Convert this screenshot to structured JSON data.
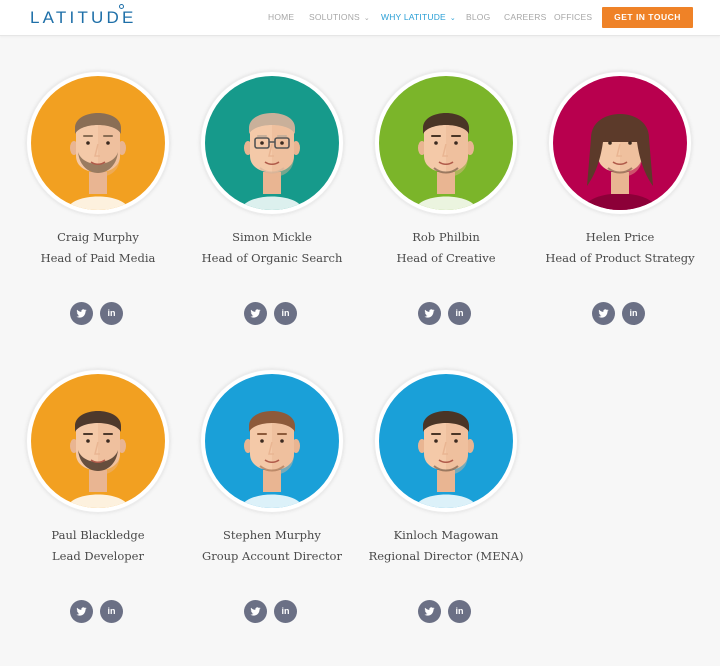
{
  "header": {
    "logo": "LATITUDE",
    "nav": [
      {
        "label": "HOME"
      },
      {
        "label": "SOLUTIONS"
      },
      {
        "label": "WHY LATITUDE"
      },
      {
        "label": "BLOG"
      },
      {
        "label": "CAREERS"
      },
      {
        "label": "OFFICES"
      }
    ],
    "cta": "GET IN TOUCH"
  },
  "team": [
    {
      "name": "Craig Murphy",
      "role": "Head of Paid Media",
      "bg": "#f2a021",
      "hair": "#8a6e55",
      "beard": true
    },
    {
      "name": "Simon Mickle",
      "role": "Head of Organic Search",
      "bg": "#169a8b",
      "hair": "#c9b09a",
      "glasses": true
    },
    {
      "name": "Rob Philbin",
      "role": "Head of Creative",
      "bg": "#7bb52a",
      "hair": "#4a3526"
    },
    {
      "name": "Helen Price",
      "role": "Head of Product Strategy",
      "bg": "#b8004e",
      "hair": "#5c3a2a",
      "female": true
    },
    {
      "name": "Paul Blackledge",
      "role": "Lead Developer",
      "bg": "#f2a021",
      "hair": "#4e392c",
      "beard": true
    },
    {
      "name": "Stephen Murphy",
      "role": "Group Account Director",
      "bg": "#1aa0d8",
      "hair": "#8d5a3a"
    },
    {
      "name": "Kinloch Magowan",
      "role": "Regional Director (MENA)",
      "bg": "#1aa0d8",
      "hair": "#4a3526"
    }
  ],
  "social": {
    "twitter_icon": "twitter-icon",
    "linkedin_icon": "linkedin-icon",
    "linkedin_label": "in"
  },
  "colors": {
    "accent": "#ef8227",
    "link": "#2a9fd6",
    "social_bg": "#6b7085"
  }
}
